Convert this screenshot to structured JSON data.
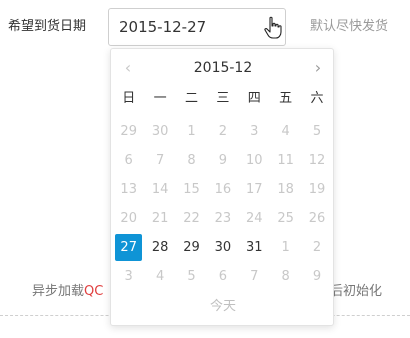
{
  "form": {
    "label": "希望到货日期",
    "date_value": "2015-12-27",
    "hint": "默认尽快发货"
  },
  "background": {
    "left_text_prefix": "异步加载",
    "left_text_red": "QC",
    "right_text": "后初始化"
  },
  "calendar": {
    "title": "2015-12",
    "prev_label": "‹",
    "next_label": "›",
    "weekdays": [
      "日",
      "一",
      "二",
      "三",
      "四",
      "五",
      "六"
    ],
    "weeks": [
      [
        {
          "d": "29",
          "m": true
        },
        {
          "d": "30",
          "m": true
        },
        {
          "d": "1",
          "m": true
        },
        {
          "d": "2",
          "m": true
        },
        {
          "d": "3",
          "m": true
        },
        {
          "d": "4",
          "m": true
        },
        {
          "d": "5",
          "m": true
        }
      ],
      [
        {
          "d": "6",
          "m": true
        },
        {
          "d": "7",
          "m": true
        },
        {
          "d": "8",
          "m": true
        },
        {
          "d": "9",
          "m": true
        },
        {
          "d": "10",
          "m": true
        },
        {
          "d": "11",
          "m": true
        },
        {
          "d": "12",
          "m": true
        }
      ],
      [
        {
          "d": "13",
          "m": true
        },
        {
          "d": "14",
          "m": true
        },
        {
          "d": "15",
          "m": true
        },
        {
          "d": "16",
          "m": true
        },
        {
          "d": "17",
          "m": true
        },
        {
          "d": "18",
          "m": true
        },
        {
          "d": "19",
          "m": true
        }
      ],
      [
        {
          "d": "20",
          "m": true
        },
        {
          "d": "21",
          "m": true
        },
        {
          "d": "22",
          "m": true
        },
        {
          "d": "23",
          "m": true
        },
        {
          "d": "24",
          "m": true
        },
        {
          "d": "25",
          "m": true
        },
        {
          "d": "26",
          "m": true
        }
      ],
      [
        {
          "d": "27",
          "m": false,
          "sel": true
        },
        {
          "d": "28",
          "m": false
        },
        {
          "d": "29",
          "m": false
        },
        {
          "d": "30",
          "m": false
        },
        {
          "d": "31",
          "m": false
        },
        {
          "d": "1",
          "m": true
        },
        {
          "d": "2",
          "m": true
        }
      ],
      [
        {
          "d": "3",
          "m": true
        },
        {
          "d": "4",
          "m": true
        },
        {
          "d": "5",
          "m": true
        },
        {
          "d": "6",
          "m": true
        },
        {
          "d": "7",
          "m": true
        },
        {
          "d": "8",
          "m": true
        },
        {
          "d": "9",
          "m": true
        }
      ]
    ],
    "today_label": "今天",
    "selected_color": "#0f94d6"
  }
}
